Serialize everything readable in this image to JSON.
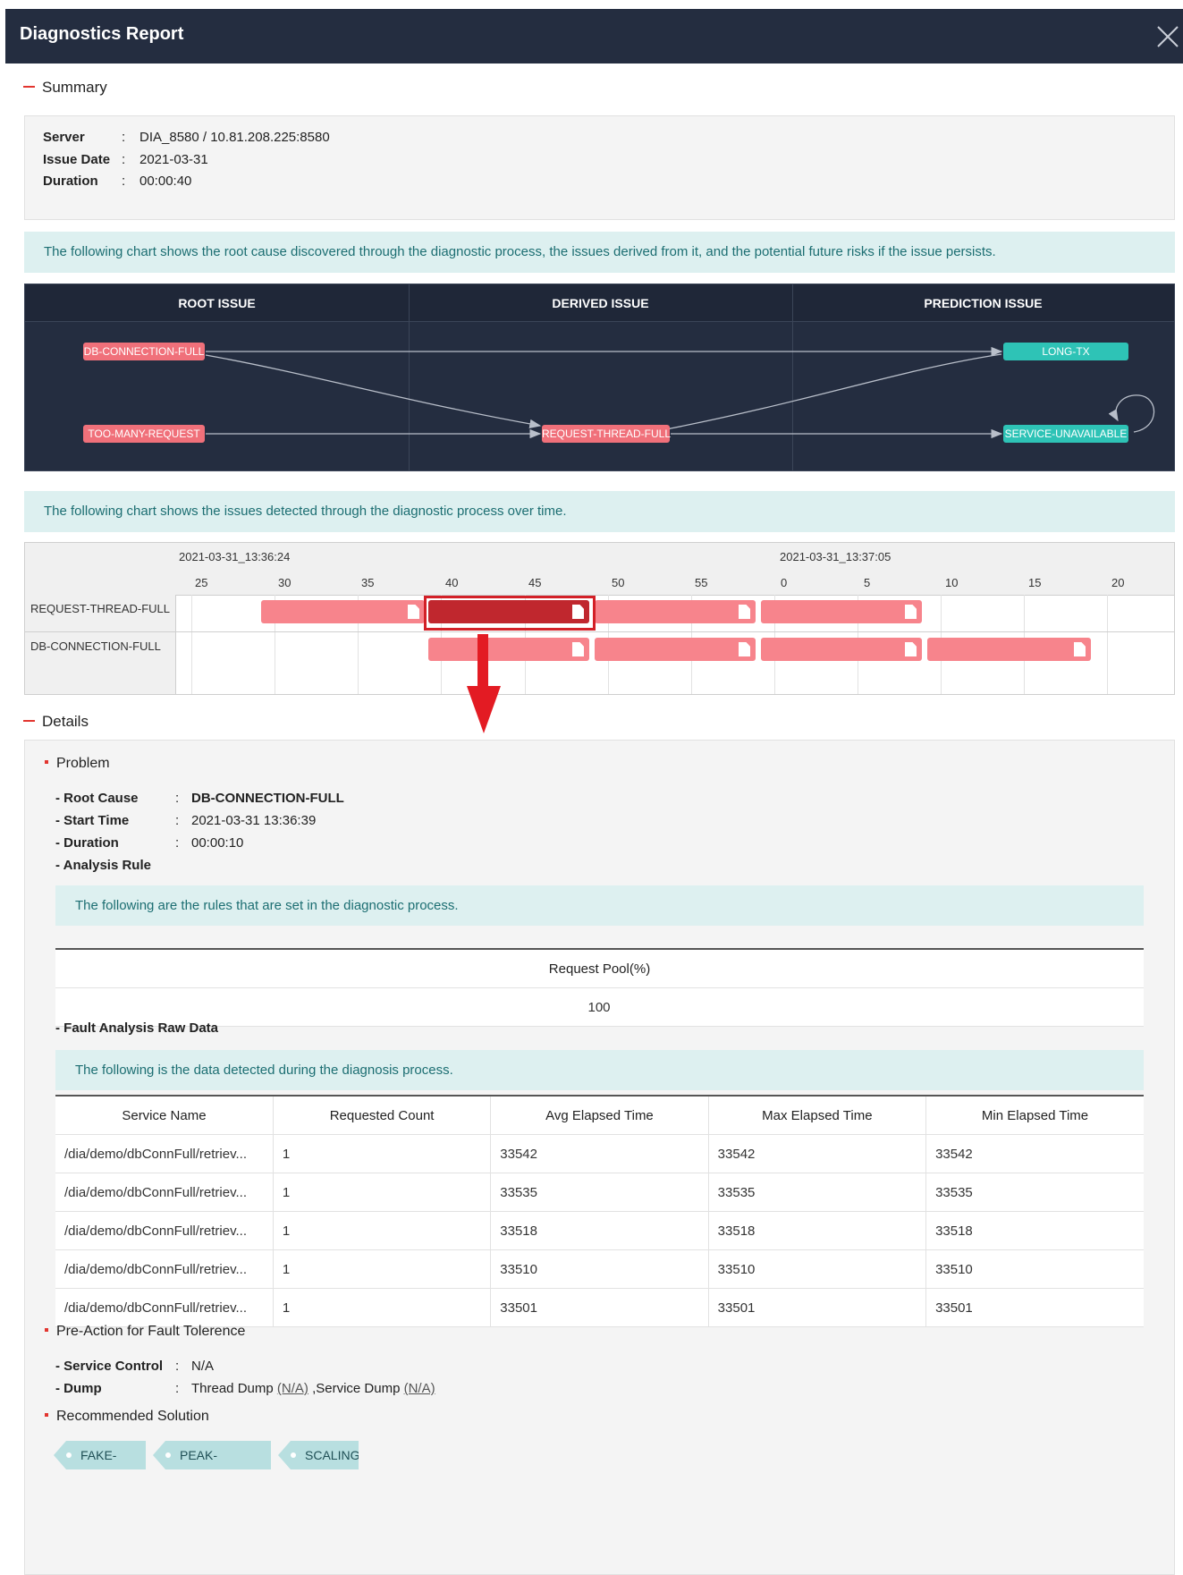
{
  "window": {
    "title": "Diagnostics Report"
  },
  "summary": {
    "heading": "Summary",
    "server_label": "Server",
    "server_value": "DIA_8580 / 10.81.208.225:8580",
    "issue_date_label": "Issue Date",
    "issue_date_value": "2021-03-31",
    "duration_label": "Duration",
    "duration_value": "00:00:40",
    "separator": ":"
  },
  "flow_chart": {
    "note": "The following chart shows the root cause discovered through the diagnostic process, the issues derived from it, and the potential future risks if the issue persists.",
    "columns": [
      "ROOT ISSUE",
      "DERIVED ISSUE",
      "PREDICTION ISSUE"
    ],
    "nodes": {
      "db_connection_full": "DB-CONNECTION-FULL",
      "too_many_request": "TOO-MANY-REQUEST",
      "request_thread_full": "REQUEST-THREAD-FULL",
      "long_tx": "LONG-TX",
      "service_unavailable": "SERVICE-UNAVAILABLE"
    },
    "colors": {
      "root": "#f0707a",
      "prediction": "#2ec3b6",
      "background": "#242d40"
    }
  },
  "timeline": {
    "note": "The following chart shows the issues detected through the diagnostic process over time.",
    "date_start": "2021-03-31_13:36:24",
    "date_mid": "2021-03-31_13:37:05",
    "ticks": [
      "25",
      "30",
      "35",
      "40",
      "45",
      "50",
      "55",
      "0",
      "5",
      "10",
      "15",
      "20"
    ],
    "rows": [
      "REQUEST-THREAD-FULL",
      "DB-CONNECTION-FULL"
    ]
  },
  "details": {
    "heading": "Details",
    "problem": {
      "heading": "Problem",
      "root_cause_label": "- Root Cause",
      "root_cause_value": "DB-CONNECTION-FULL",
      "start_time_label": "- Start Time",
      "start_time_value": "2021-03-31 13:36:39",
      "duration_label": "- Duration",
      "duration_value": "00:00:10",
      "analysis_rule_label": "- Analysis Rule",
      "rules_note": "The following are the rules that are set in the diagnostic process.",
      "rule_header": "Request Pool(%)",
      "rule_value": "100"
    },
    "raw_data": {
      "heading": "- Fault Analysis Raw Data",
      "note": "The following is the data detected during the diagnosis process.",
      "headers": [
        "Service Name",
        "Requested Count",
        "Avg Elapsed Time",
        "Max Elapsed Time",
        "Min Elapsed Time"
      ],
      "rows": [
        [
          "/dia/demo/dbConnFull/retriev...",
          "1",
          "33542",
          "33542",
          "33542"
        ],
        [
          "/dia/demo/dbConnFull/retriev...",
          "1",
          "33535",
          "33535",
          "33535"
        ],
        [
          "/dia/demo/dbConnFull/retriev...",
          "1",
          "33518",
          "33518",
          "33518"
        ],
        [
          "/dia/demo/dbConnFull/retriev...",
          "1",
          "33510",
          "33510",
          "33510"
        ],
        [
          "/dia/demo/dbConnFull/retriev...",
          "1",
          "33501",
          "33501",
          "33501"
        ]
      ]
    },
    "pre_action": {
      "heading": "Pre-Action for Fault Tolerence",
      "service_control_label": "- Service Control",
      "service_control_value": "N/A",
      "dump_label": "- Dump",
      "dump_thread": "Thread Dump",
      "dump_thread_link": "(N/A)",
      "dump_service": ",Service Dump",
      "dump_service_link": "(N/A)"
    },
    "recommended": {
      "heading": "Recommended Solution",
      "tags": [
        "FAKE-PAGE",
        "PEAK-CONTROL",
        "SCALING"
      ]
    }
  }
}
